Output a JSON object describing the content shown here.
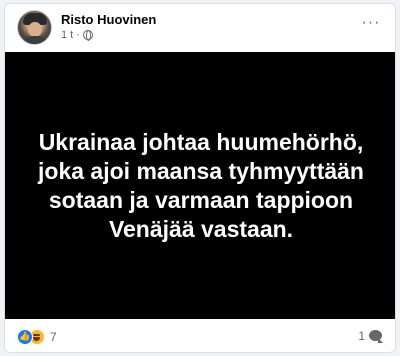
{
  "post": {
    "author": "Risto Huovinen",
    "time": "1 t",
    "separator": "·",
    "privacy_icon": "globe-icon",
    "more_icon": "more-options-icon",
    "more_glyph": "···",
    "image_text": "Ukrainaa johtaa huumehörhö, joka ajoi maansa tyhmyyttään sotaan ja varmaan tappioon Venäjää vastaan.",
    "reactions": {
      "icons": [
        "like-icon",
        "haha-icon"
      ],
      "count": "7"
    },
    "comments": {
      "count": "1",
      "icon": "comment-icon"
    }
  },
  "colors": {
    "like": "#1877f2",
    "haha": "#f7b928",
    "image_background": "#000000",
    "image_text": "#ffffff"
  }
}
